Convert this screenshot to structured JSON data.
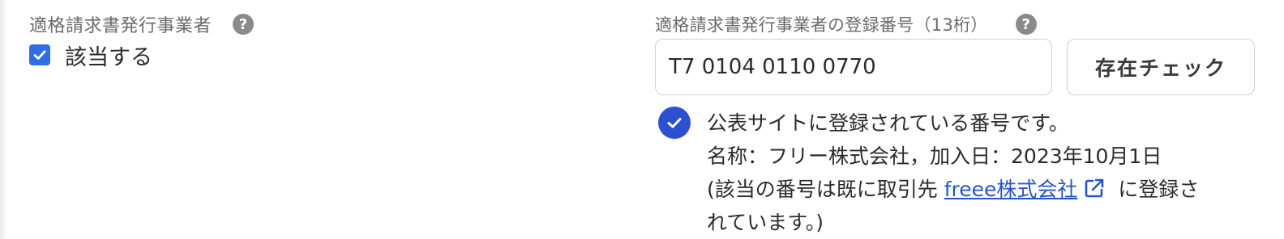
{
  "qualified_invoice": {
    "label": "適格請求書発行事業者",
    "help_icon": "?",
    "checkbox_checked": true,
    "checkbox_label": "該当する"
  },
  "registration_number": {
    "label": "適格請求書発行事業者の登録番号（13桁）",
    "help_icon": "?",
    "input_value": "T7 0104 0110 0770",
    "check_button_label": "存在チェック"
  },
  "result": {
    "line1": "公表サイトに登録されている番号です。",
    "line2": "名称：フリー株式会社，加入日：2023年10月1日",
    "line3_prefix": "(該当の番号は既に取引先 ",
    "partner_link": "freee株式会社",
    "line3_suffix": " に登録さ",
    "line4": "れています。)"
  },
  "colors": {
    "accent": "#2f6fe4",
    "success": "#2d4fd1",
    "link": "#2457c5",
    "label": "#6b6b6b"
  },
  "icons": {
    "help": "question-circle-icon",
    "checkbox": "checkmark-icon",
    "success": "check-circle-icon",
    "external": "external-link-icon"
  }
}
